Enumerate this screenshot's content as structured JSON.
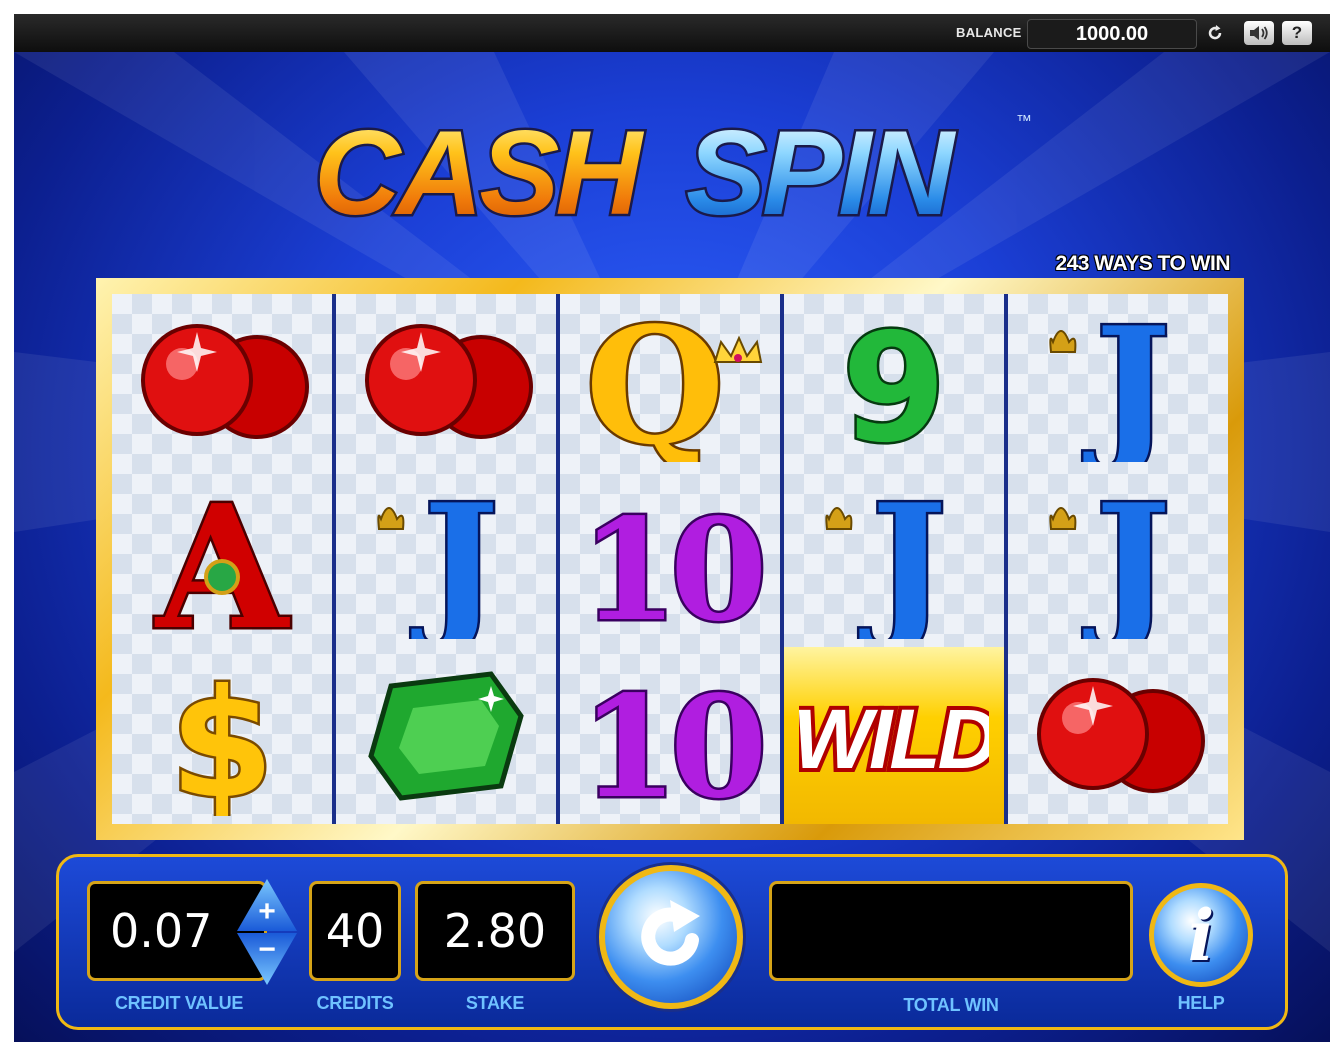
{
  "topbar": {
    "balance_label": "BALANCE",
    "balance_value": "1000.00",
    "icons": [
      "refresh-icon",
      "sound-icon",
      "help-question-icon"
    ],
    "help_glyph": "?"
  },
  "logo": {
    "word1": "CASH",
    "word2": "SPIN",
    "trademark": "™"
  },
  "ways_to_win": "243 WAYS TO WIN",
  "reels": [
    [
      "red-gems",
      "ace-a",
      "dollar-sign"
    ],
    [
      "red-gems",
      "jack-j",
      "green-emerald"
    ],
    [
      "queen-q",
      "ten-10",
      "ten-10"
    ],
    [
      "nine-9",
      "jack-j",
      "wild"
    ],
    [
      "jack-j",
      "jack-j",
      "red-gems"
    ]
  ],
  "symbol_text": {
    "ace": "A",
    "jack": "J",
    "queen": "Q",
    "ten": "10",
    "nine": "9",
    "wild": "WILD",
    "dollar": "$"
  },
  "controls": {
    "credit_value": "0.07",
    "credit_value_label": "CREDIT VALUE",
    "plus_glyph": "+",
    "minus_glyph": "−",
    "credits": "40",
    "credits_label": "CREDITS",
    "stake": "2.80",
    "stake_label": "STAKE",
    "total_win": "",
    "total_win_label": "TOTAL WIN",
    "help_label": "HELP",
    "help_glyph": "i"
  },
  "colors": {
    "accent_gold": "#f0b814",
    "label_blue": "#6fc2ff",
    "background_blue": "#1b3fd6"
  }
}
